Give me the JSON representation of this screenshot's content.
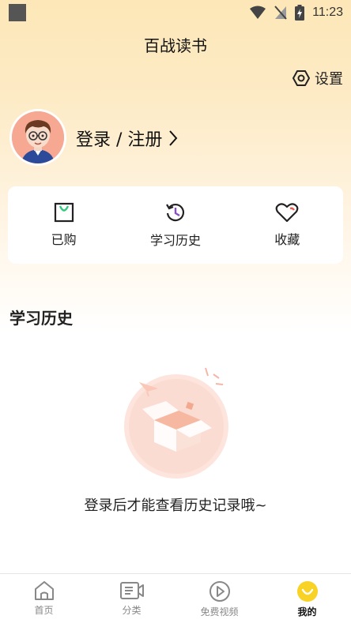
{
  "status_bar": {
    "time": "11:23"
  },
  "header": {
    "title": "百战读书"
  },
  "settings": {
    "label": "设置"
  },
  "user": {
    "login_label": "登录 / 注册"
  },
  "quick_actions": [
    {
      "label": "已购",
      "icon": "shopping-bag-icon"
    },
    {
      "label": "学习历史",
      "icon": "history-icon"
    },
    {
      "label": "收藏",
      "icon": "heart-icon"
    }
  ],
  "history_section": {
    "title": "学习历史",
    "empty_message": "登录后才能查看历史记录哦~"
  },
  "tabbar": {
    "items": [
      {
        "label": "首页",
        "icon": "home-icon"
      },
      {
        "label": "分类",
        "icon": "category-icon"
      },
      {
        "label": "免费视频",
        "icon": "play-icon"
      },
      {
        "label": "我的",
        "icon": "profile-icon"
      }
    ],
    "active_index": 3
  },
  "colors": {
    "accent_yellow": "#f8d224",
    "accent_green": "#2ec97a",
    "accent_red": "#ee5a4a",
    "accent_purple": "#8a4fc8"
  }
}
